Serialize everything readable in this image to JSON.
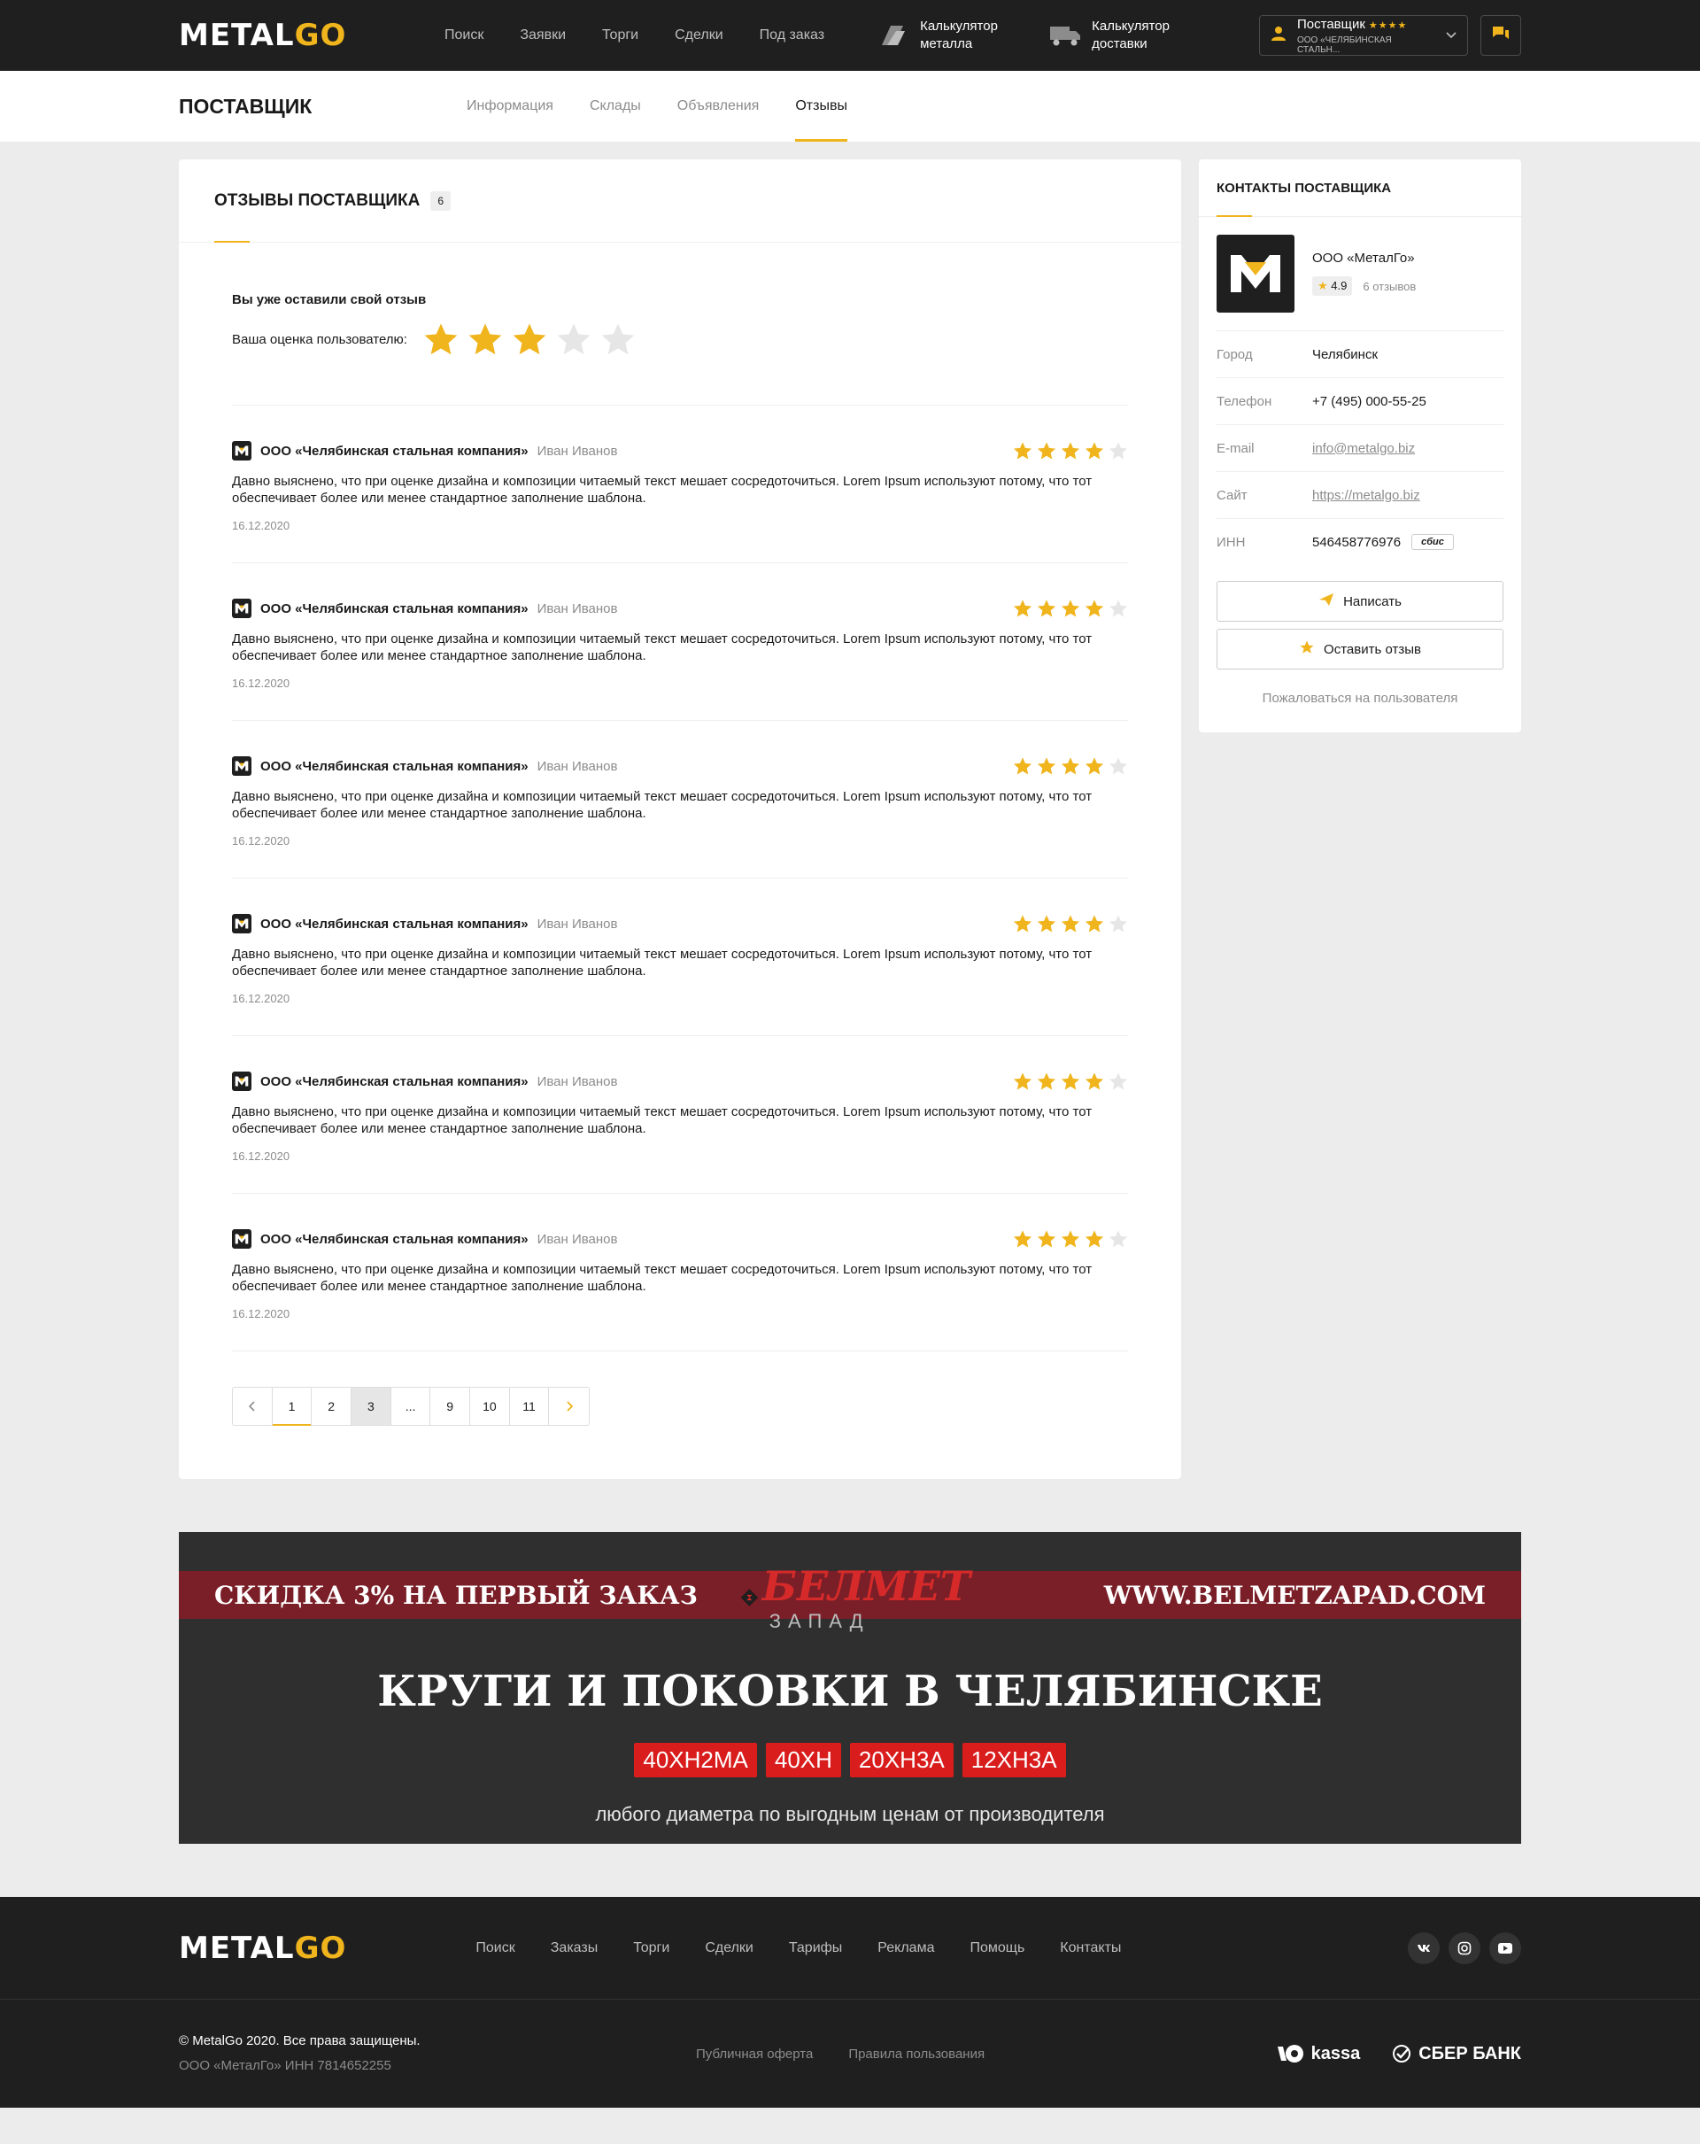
{
  "header": {
    "logo_metal": "METAL",
    "logo_go": "GO",
    "nav": [
      "Поиск",
      "Заявки",
      "Торги",
      "Сделки",
      "Под заказ"
    ],
    "calc_metal": "Калькулятор металла",
    "calc_delivery": "Калькулятор доставки",
    "user_role": "Поставщик",
    "user_stars": "★★★★",
    "user_company": "ООО «ЧЕЛЯБИНСКАЯ СТАЛЬН..."
  },
  "subheader": {
    "title": "ПОСТАВЩИК",
    "tabs": [
      "Информация",
      "Склады",
      "Объявления",
      "Отзывы"
    ],
    "active_tab": "Отзывы"
  },
  "reviews": {
    "title": "ОТЗЫВЫ ПОСТАВЩИКА",
    "count": "6",
    "own_title": "Вы уже оставили свой отзыв",
    "own_label": "Ваша оценка пользователю:",
    "own_rating": 3,
    "items": [
      {
        "company": "ООО «Челябинская стальная компания»",
        "author": "Иван Иванов",
        "rating": 4,
        "text": "Давно выяснено, что при оценке дизайна и композиции читаемый текст мешает сосредоточиться. Lorem Ipsum используют потому, что тот обеспечивает более или менее стандартное заполнение шаблона.",
        "date": "16.12.2020"
      },
      {
        "company": "ООО «Челябинская стальная компания»",
        "author": "Иван Иванов",
        "rating": 4,
        "text": "Давно выяснено, что при оценке дизайна и композиции читаемый текст мешает сосредоточиться. Lorem Ipsum используют потому, что тот обеспечивает более или менее стандартное заполнение шаблона.",
        "date": "16.12.2020"
      },
      {
        "company": "ООО «Челябинская стальная компания»",
        "author": "Иван Иванов",
        "rating": 4,
        "text": "Давно выяснено, что при оценке дизайна и композиции читаемый текст мешает сосредоточиться. Lorem Ipsum используют потому, что тот обеспечивает более или менее стандартное заполнение шаблона.",
        "date": "16.12.2020"
      },
      {
        "company": "ООО «Челябинская стальная компания»",
        "author": "Иван Иванов",
        "rating": 4,
        "text": "Давно выяснено, что при оценке дизайна и композиции читаемый текст мешает сосредоточиться. Lorem Ipsum используют потому, что тот обеспечивает более или менее стандартное заполнение шаблона.",
        "date": "16.12.2020"
      },
      {
        "company": "ООО «Челябинская стальная компания»",
        "author": "Иван Иванов",
        "rating": 4,
        "text": "Давно выяснено, что при оценке дизайна и композиции читаемый текст мешает сосредоточиться. Lorem Ipsum используют потому, что тот обеспечивает более или менее стандартное заполнение шаблона.",
        "date": "16.12.2020"
      },
      {
        "company": "ООО «Челябинская стальная компания»",
        "author": "Иван Иванов",
        "rating": 4,
        "text": "Давно выяснено, что при оценке дизайна и композиции читаемый текст мешает сосредоточиться. Lorem Ipsum используют потому, что тот обеспечивает более или менее стандартное заполнение шаблона.",
        "date": "16.12.2020"
      }
    ],
    "pagination": {
      "prev": "‹",
      "pages": [
        "1",
        "2",
        "3",
        "...",
        "9",
        "10",
        "11"
      ],
      "current": "3",
      "next": "›"
    }
  },
  "contacts": {
    "title": "КОНТАКТЫ ПОСТАВЩИКА",
    "company": "ООО «МеталГо»",
    "rating": "4.9",
    "reviews_count": "6 отзывов",
    "rows": [
      {
        "key": "Город",
        "value": "Челябинск"
      },
      {
        "key": "Телефон",
        "value": "+7 (495) 000-55-25"
      },
      {
        "key": "E-mail",
        "value": "info@metalgo.biz"
      },
      {
        "key": "Сайт",
        "value": "https://metalgo.biz"
      },
      {
        "key": "ИНН",
        "value": "546458776976"
      }
    ],
    "inn_badge": "сбис",
    "write_btn": "Написать",
    "review_btn": "Оставить отзыв",
    "report": "Пожаловаться на пользователя"
  },
  "banner": {
    "discount": "СКИДКА 3% НА ПЕРВЫЙ ЗАКАЗ",
    "site": "WWW.BELMETZAPAD.COM",
    "brand_top": "БЕЛМЕТ",
    "brand_bottom": "ЗАПАД",
    "headline": "КРУГИ И ПОКОВКИ В ЧЕЛЯБИНСКЕ",
    "grades": [
      "40ХН2МА",
      "40ХН",
      "20ХН3А",
      "12ХН3А"
    ],
    "sub": "любого диаметра по выгодным ценам от производителя"
  },
  "footer": {
    "nav": [
      "Поиск",
      "Заказы",
      "Торги",
      "Сделки",
      "Тарифы",
      "Реклама",
      "Помощь",
      "Контакты"
    ],
    "social": [
      "vk-icon",
      "instagram-icon",
      "youtube-icon"
    ],
    "copyright": "© MetalGo 2020. Все права защищены.",
    "legal": "ООО «МеталГо» ИНН 7814652255",
    "links": [
      "Публичная оферта",
      "Правила пользования"
    ],
    "pay_kassa": "kassa",
    "pay_sber": "СБЕР БАНК"
  },
  "colors": {
    "accent": "#f0b41c",
    "dark": "#1f1f1f",
    "banner_red": "#d91c1c",
    "stripe": "#7a1f28"
  }
}
